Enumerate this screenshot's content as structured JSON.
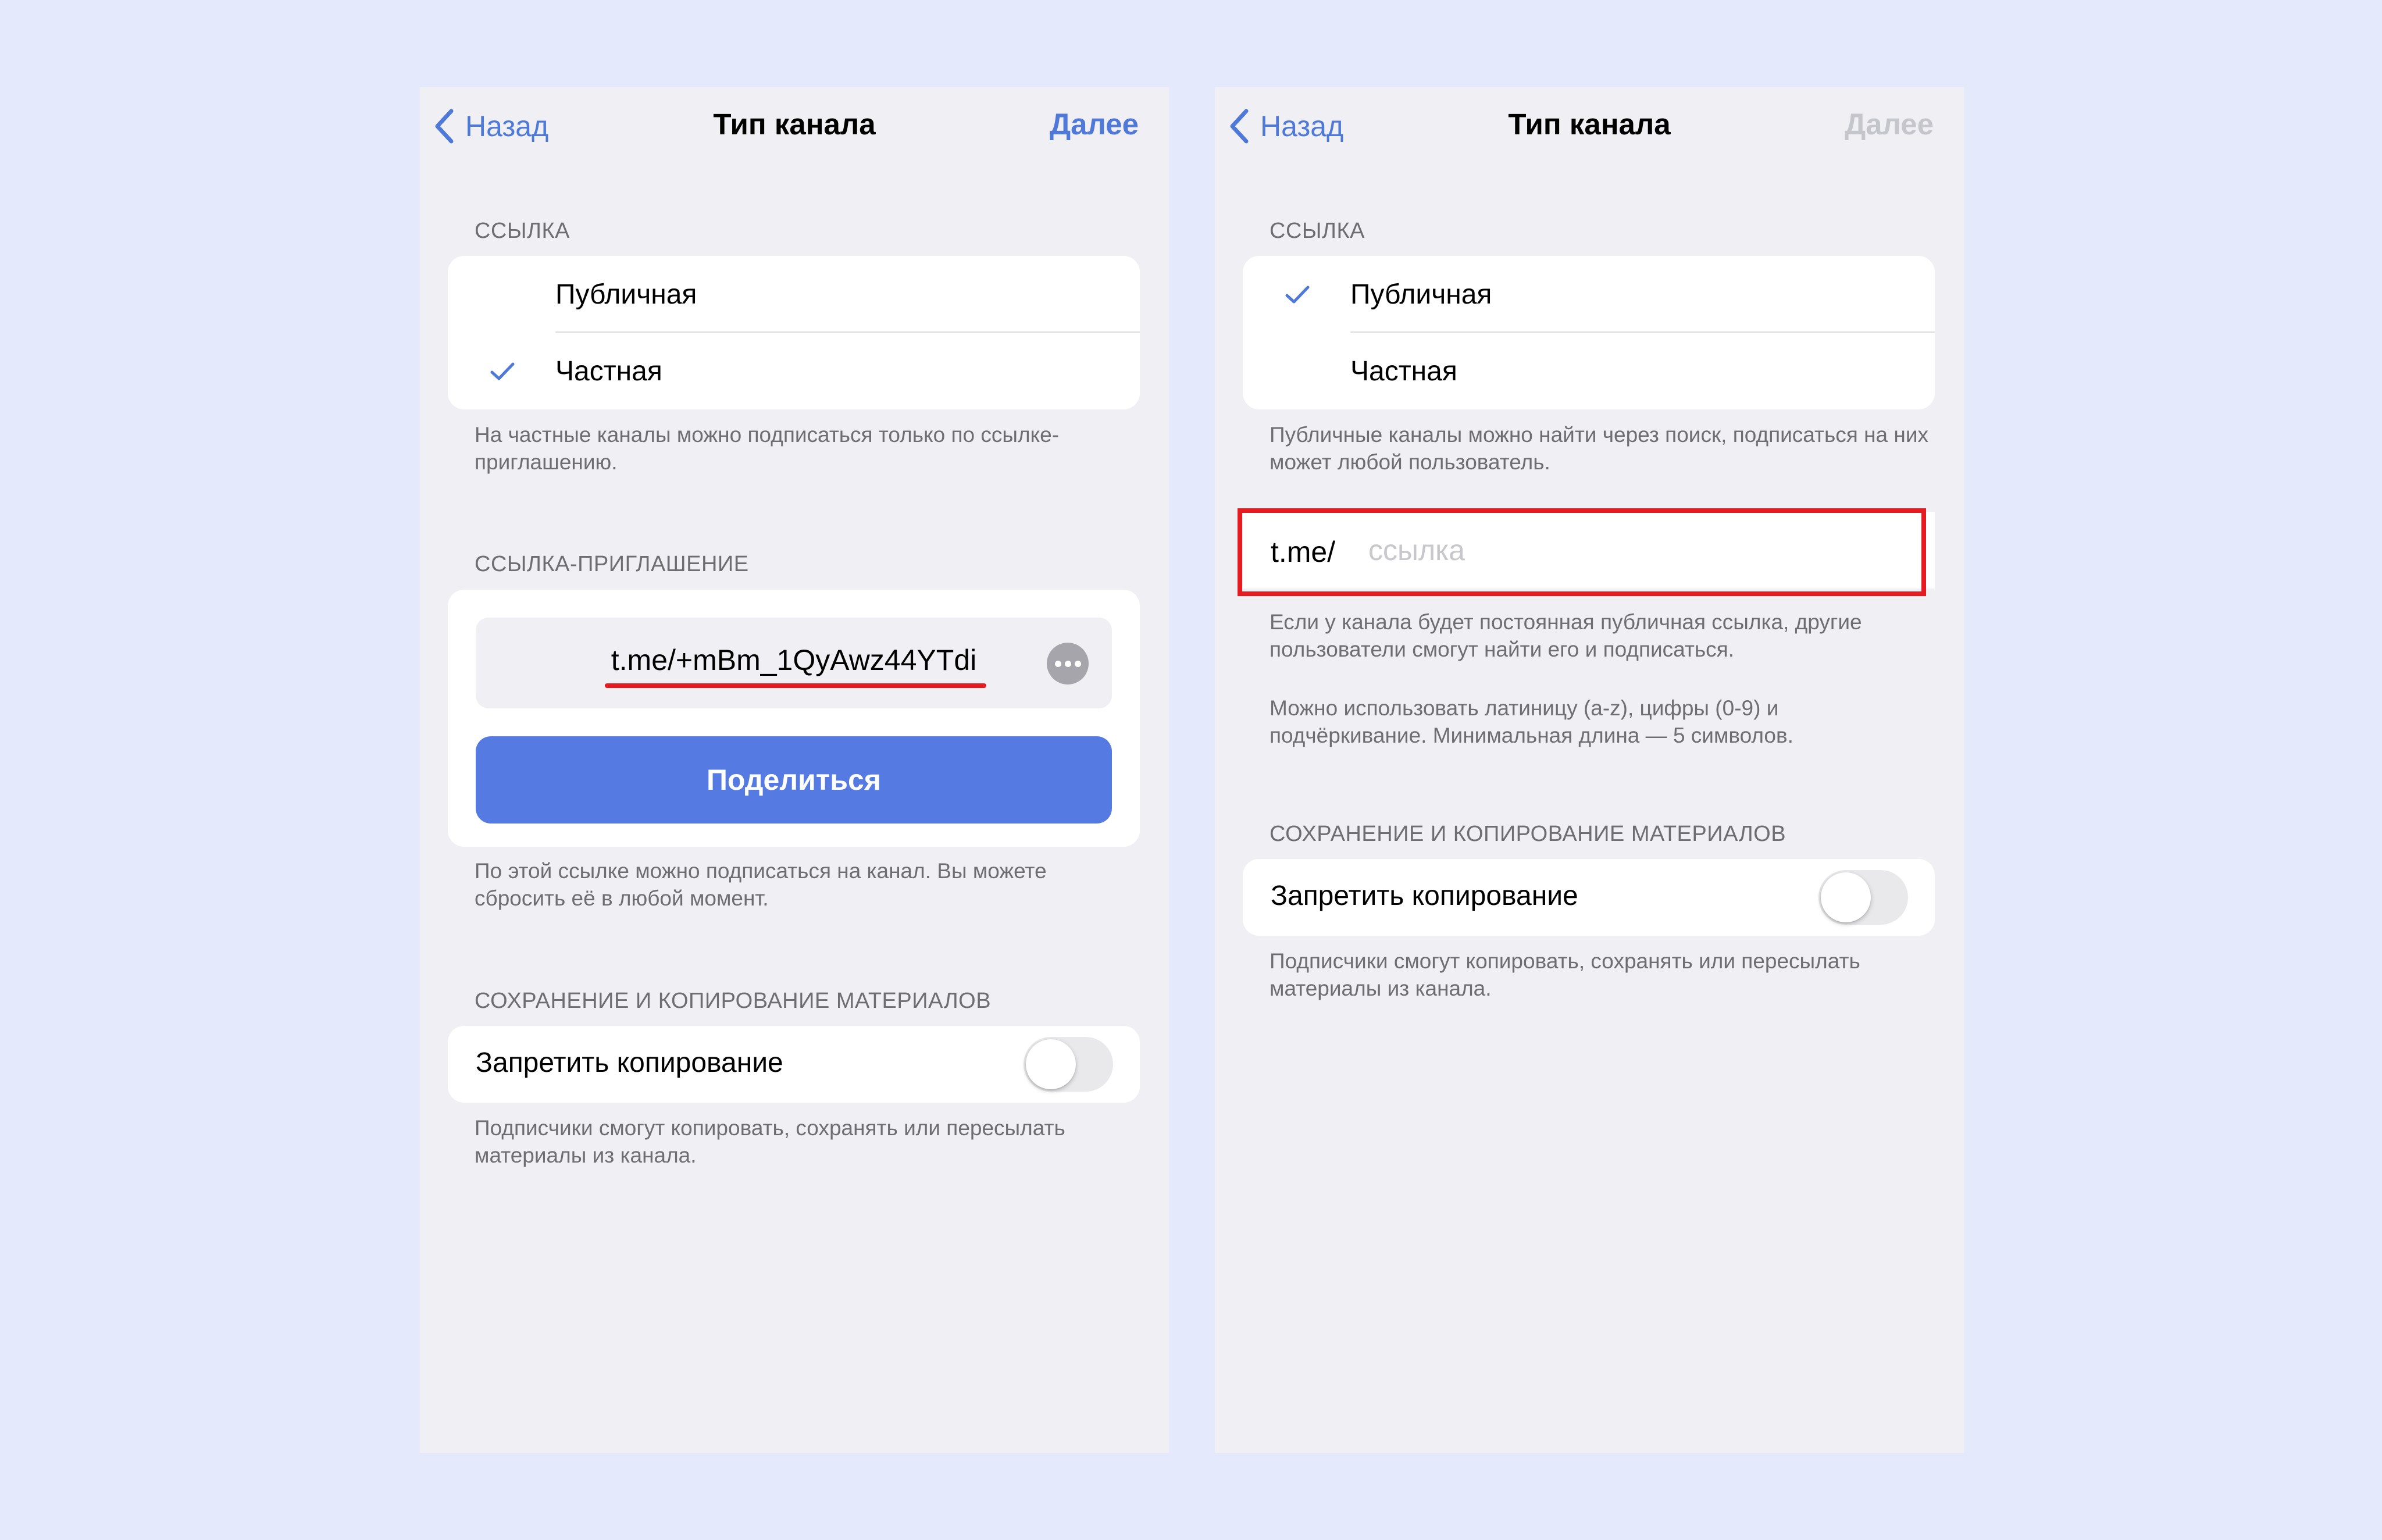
{
  "left_screen": {
    "nav": {
      "back_label": "Назад",
      "title": "Тип канала",
      "next_label": "Далее"
    },
    "link_section": {
      "header": "Ссылка",
      "options": [
        {
          "label": "Публичная",
          "selected": false
        },
        {
          "label": "Частная",
          "selected": true
        }
      ],
      "footer": "На частные каналы можно подписаться только по ссылке-приглашению."
    },
    "invite_section": {
      "header": "Ссылка-приглашение",
      "link": "t.me/+mBm_1QyAwz44YTdi",
      "share_label": "Поделиться",
      "footer": "По этой ссылке можно подписаться на канал. Вы можете сбросить её в любой момент."
    },
    "copy_section": {
      "header": "Сохранение и копирование материалов",
      "toggle_label": "Запретить копирование",
      "toggle_on": false,
      "footer": "Подписчики смогут копировать, сохранять или пересылать материалы из канала."
    }
  },
  "right_screen": {
    "nav": {
      "back_label": "Назад",
      "title": "Тип канала",
      "next_label": "Далее",
      "next_enabled": false
    },
    "link_section": {
      "header": "Ссылка",
      "options": [
        {
          "label": "Публичная",
          "selected": true
        },
        {
          "label": "Частная",
          "selected": false
        }
      ],
      "footer": "Публичные каналы можно найти через поиск, подписаться на них может любой пользователь."
    },
    "public_link": {
      "prefix": "t.me/",
      "value": "",
      "placeholder": "ссылка",
      "footer_1": "Если у канала будет постоянная публичная ссылка, другие пользователи смогут найти его и подписаться.",
      "footer_2": "Можно использовать латиницу (a-z), цифры (0-9) и подчёркивание. Минимальная длина — 5 символов."
    },
    "copy_section": {
      "header": "Сохранение и копирование материалов",
      "toggle_label": "Запретить копирование",
      "toggle_on": false,
      "footer": "Подписчики смогут копировать, сохранять или пересылать материалы из канала."
    }
  },
  "colors": {
    "background": "#e4e9fb",
    "screen": "#efeff4",
    "accent": "#557be3",
    "link": "#4e79d8",
    "highlight": "#e51b22",
    "secondary_text": "#6d6d72"
  },
  "icons": {
    "back": "chevron-left-icon",
    "check": "checkmark-icon",
    "more": "more-horizontal-icon"
  }
}
